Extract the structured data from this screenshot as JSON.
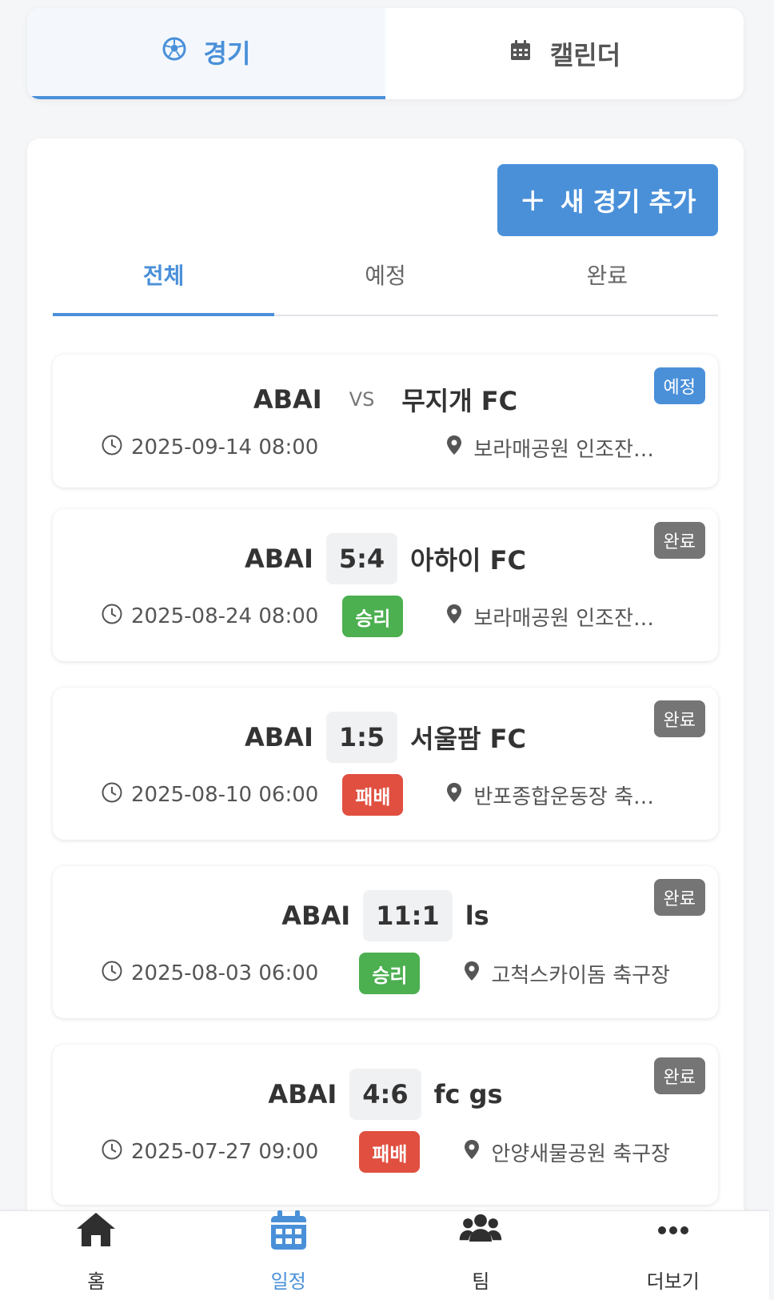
{
  "top_tabs": [
    {
      "label": "경기",
      "icon": "soccer-ball-icon",
      "active": true
    },
    {
      "label": "캘린더",
      "icon": "calendar-icon",
      "active": false
    }
  ],
  "add_button": {
    "label": "새 경기 추가",
    "icon": "plus-icon"
  },
  "filter_tabs": [
    {
      "label": "전체",
      "active": true
    },
    {
      "label": "예정",
      "active": false
    },
    {
      "label": "완료",
      "active": false
    }
  ],
  "vs_label": "VS",
  "matches": [
    {
      "home": "ABAI",
      "score": null,
      "opponent": "무지개 FC",
      "status": "예정",
      "status_color": "#4a90d9",
      "datetime": "2025-09-14 08:00",
      "result": null,
      "result_color": null,
      "venue": "보라매공원 인조잔…"
    },
    {
      "home": "ABAI",
      "score": "5:4",
      "opponent": "아하이 FC",
      "status": "완료",
      "status_color": "#757575",
      "datetime": "2025-08-24 08:00",
      "result": "승리",
      "result_color": "#4caf50",
      "venue": "보라매공원 인조잔…"
    },
    {
      "home": "ABAI",
      "score": "1:5",
      "opponent": "서울팜 FC",
      "status": "완료",
      "status_color": "#757575",
      "datetime": "2025-08-10 06:00",
      "result": "패배",
      "result_color": "#e04f3f",
      "venue": "반포종합운동장 축…"
    },
    {
      "home": "ABAI",
      "score": "11:1",
      "opponent": "ls",
      "status": "완료",
      "status_color": "#757575",
      "datetime": "2025-08-03 06:00",
      "result": "승리",
      "result_color": "#4caf50",
      "venue": "고척스카이돔 축구장"
    },
    {
      "home": "ABAI",
      "score": "4:6",
      "opponent": "fc gs",
      "status": "완료",
      "status_color": "#757575",
      "datetime": "2025-07-27 09:00",
      "result": "패배",
      "result_color": "#e04f3f",
      "venue": "안양새물공원 축구장"
    }
  ],
  "bottom_nav": [
    {
      "label": "홈",
      "icon": "home-icon",
      "active": false
    },
    {
      "label": "일정",
      "icon": "calendar-icon",
      "active": true
    },
    {
      "label": "팀",
      "icon": "users-icon",
      "active": false
    },
    {
      "label": "더보기",
      "icon": "more-icon",
      "active": false
    }
  ],
  "colors": {
    "accent": "#4a90d9",
    "win": "#4caf50",
    "loss": "#e04f3f",
    "done": "#757575"
  }
}
